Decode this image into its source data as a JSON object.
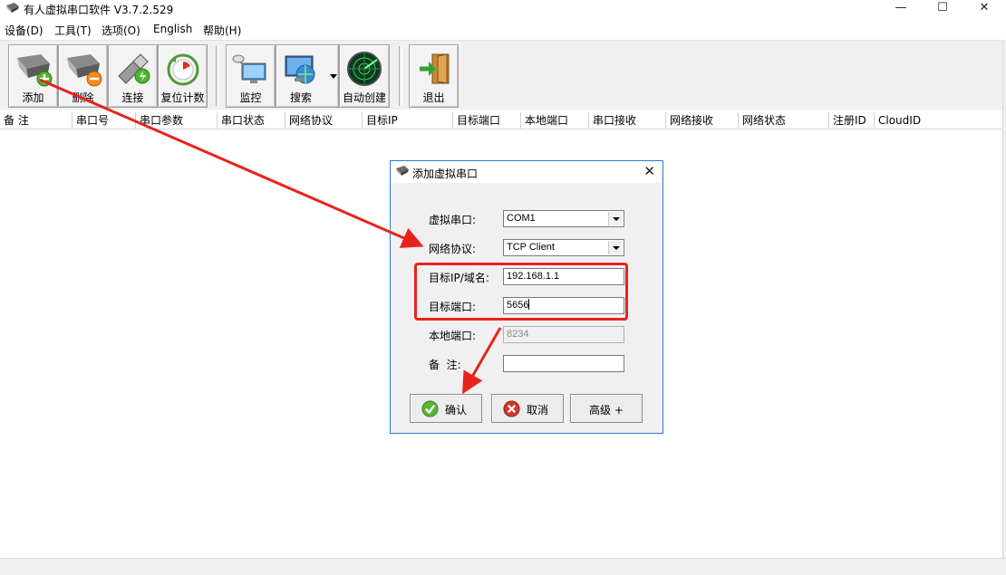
{
  "window": {
    "title": "有人虚拟串口软件 V3.7.2.529",
    "minimize_glyph": "—",
    "maximize_glyph": "☐",
    "close_glyph": "✕"
  },
  "menu": {
    "items": [
      "设备(D)",
      "工具(T)",
      "选项(O)",
      "English",
      "帮助(H)"
    ]
  },
  "toolbar": {
    "buttons": [
      {
        "label": "添加",
        "icon": "serial-port-add-icon"
      },
      {
        "label": "删除",
        "icon": "serial-port-delete-icon"
      },
      {
        "label": "连接",
        "icon": "connect-plug-icon"
      },
      {
        "label": "复位计数",
        "icon": "reset-counter-icon"
      },
      {
        "label": "监控",
        "icon": "monitor-icon"
      },
      {
        "label": "搜索",
        "icon": "search-globe-icon"
      },
      {
        "label": "自动创建",
        "icon": "radar-icon"
      },
      {
        "label": "退出",
        "icon": "exit-door-icon"
      }
    ]
  },
  "table": {
    "columns": [
      "备 注",
      "串口号",
      "串口参数",
      "串口状态",
      "网络协议",
      "目标IP",
      "目标端口",
      "本地端口",
      "串口接收",
      "网络接收",
      "网络状态",
      "注册ID",
      "CloudID"
    ]
  },
  "dialog": {
    "title": "添加虚拟串口",
    "close_glyph": "✕",
    "fields": {
      "virtual_port": {
        "label": "虚拟串口:",
        "value": "COM1"
      },
      "protocol": {
        "label": "网络协议:",
        "value": "TCP Client"
      },
      "target_ip": {
        "label": "目标IP/域名:",
        "value": "192.168.1.1"
      },
      "target_port": {
        "label": "目标端口:",
        "value": "5656"
      },
      "local_port": {
        "label": "本地端口:",
        "value": "8234"
      },
      "remark": {
        "label": "备  注:",
        "value": ""
      }
    },
    "buttons": {
      "ok": "确认",
      "cancel": "取消",
      "advanced": "高级 +"
    }
  },
  "colors": {
    "annotation_red": "#e8231c",
    "dialog_border": "#2b79d0"
  }
}
